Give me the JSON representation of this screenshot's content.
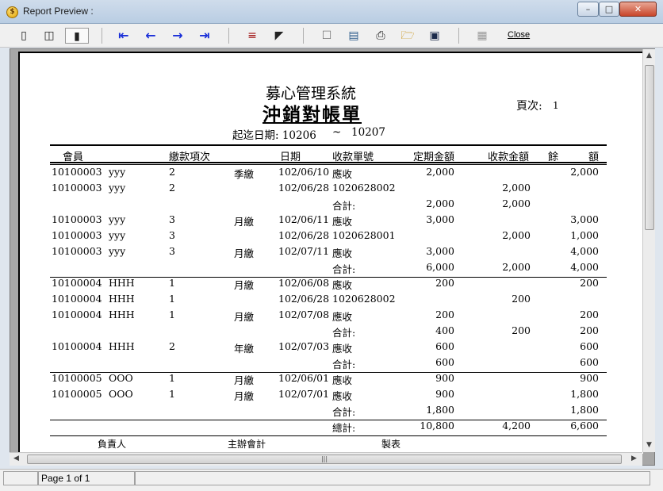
{
  "window": {
    "title": "Report Preview :",
    "app_icon": "app-icon"
  },
  "toolbar": {
    "close_label": "Close"
  },
  "status": {
    "page_info": "Page 1 of 1"
  },
  "report": {
    "org_title": "募心管理系統",
    "report_title": "沖銷對帳單",
    "page_label": "頁次:",
    "page_no": "1",
    "date_range_label": "起迄日期: 10206",
    "date_range_sep": "~",
    "date_range_end": "10207",
    "columns": [
      "會員",
      "繳款項次",
      "日期",
      "收款單號",
      "定期金額",
      "收款金額",
      "餘",
      "額"
    ],
    "rows": [
      [
        "10100003",
        "yyy",
        "2",
        "季繳",
        "102/06/10",
        "應收",
        "2,000",
        "",
        "2,000"
      ],
      [
        "10100003",
        "yyy",
        "2",
        "",
        "102/06/28",
        "1020628002",
        "",
        "2,000",
        ""
      ],
      [
        "",
        "",
        "",
        "",
        "",
        "合計:",
        "2,000",
        "2,000",
        ""
      ],
      [
        "10100003",
        "yyy",
        "3",
        "月繳",
        "102/06/11",
        "應收",
        "3,000",
        "",
        "3,000"
      ],
      [
        "10100003",
        "yyy",
        "3",
        "",
        "102/06/28",
        "1020628001",
        "",
        "2,000",
        "1,000"
      ],
      [
        "10100003",
        "yyy",
        "3",
        "月繳",
        "102/07/11",
        "應收",
        "3,000",
        "",
        "4,000"
      ],
      [
        "",
        "",
        "",
        "",
        "",
        "合計:",
        "6,000",
        "2,000",
        "4,000"
      ],
      [
        "10100004",
        "HHH",
        "1",
        "月繳",
        "102/06/08",
        "應收",
        "200",
        "",
        "200"
      ],
      [
        "10100004",
        "HHH",
        "1",
        "",
        "102/06/28",
        "1020628002",
        "",
        "200",
        ""
      ],
      [
        "10100004",
        "HHH",
        "1",
        "月繳",
        "102/07/08",
        "應收",
        "200",
        "",
        "200"
      ],
      [
        "",
        "",
        "",
        "",
        "",
        "合計:",
        "400",
        "200",
        "200"
      ],
      [
        "10100004",
        "HHH",
        "2",
        "年繳",
        "102/07/03",
        "應收",
        "600",
        "",
        "600"
      ],
      [
        "",
        "",
        "",
        "",
        "",
        "合計:",
        "600",
        "",
        "600"
      ],
      [
        "10100005",
        "OOO",
        "1",
        "月繳",
        "102/06/01",
        "應收",
        "900",
        "",
        "900"
      ],
      [
        "10100005",
        "OOO",
        "1",
        "月繳",
        "102/07/01",
        "應收",
        "900",
        "",
        "1,800"
      ],
      [
        "",
        "",
        "",
        "",
        "",
        "合計:",
        "1,800",
        "",
        "1,800"
      ],
      [
        "",
        "",
        "",
        "",
        "",
        "總計:",
        "10,800",
        "4,200",
        "6,600"
      ]
    ],
    "footer": [
      "負責人",
      "主辦會計",
      "製表"
    ]
  }
}
